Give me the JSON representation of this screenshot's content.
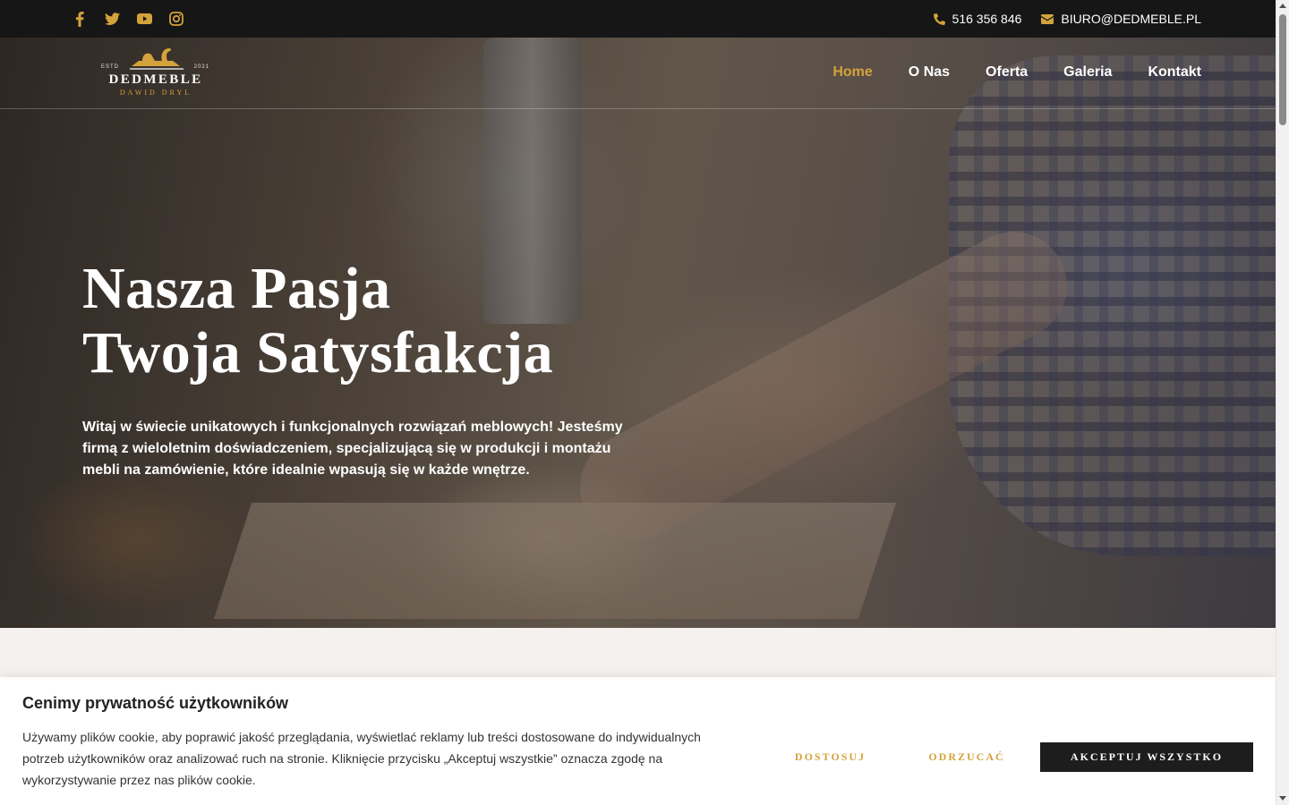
{
  "topbar": {
    "socials": [
      {
        "icon": "facebook-icon"
      },
      {
        "icon": "twitter-icon"
      },
      {
        "icon": "youtube-icon"
      },
      {
        "icon": "instagram-icon"
      }
    ],
    "phone": "516 356 846",
    "email": "BIURO@DEDMEBLE.PL"
  },
  "logo": {
    "estd": "ESTD",
    "year": "2021",
    "name": "DEDMEBLE",
    "owner": "DAWID DRYL"
  },
  "nav": {
    "items": [
      "Home",
      "O Nas",
      "Oferta",
      "Galeria",
      "Kontakt"
    ],
    "active": "Home"
  },
  "hero": {
    "title_line1": "Nasza Pasja",
    "title_line2": "Twoja Satysfakcja",
    "text": "Witaj w świecie unikatowych i funkcjonalnych rozwiązań meblowych! Jesteśmy firmą z wieloletnim doświadczeniem, specjalizującą się w produkcji i montażu mebli na zamówienie, które idealnie wpasują się w każde wnętrze."
  },
  "cookie": {
    "title": "Cenimy prywatność użytkowników",
    "text": "Używamy plików cookie, aby poprawić jakość przeglądania, wyświetlać reklamy lub treści dostosowane do indywidualnych potrzeb użytkowników oraz analizować ruch na stronie. Kliknięcie przycisku „Akceptuj wszystkie” oznacza zgodę na wykorzystywanie przez nas plików cookie.",
    "customize": "DOSTOSUJ",
    "reject": "ODRZUCAĆ",
    "accept": "AKCEPTUJ WSZYSTKO"
  },
  "colors": {
    "accent": "#d4a23b",
    "topbar_bg": "#161616",
    "accept_bg": "#1d1d1d"
  }
}
